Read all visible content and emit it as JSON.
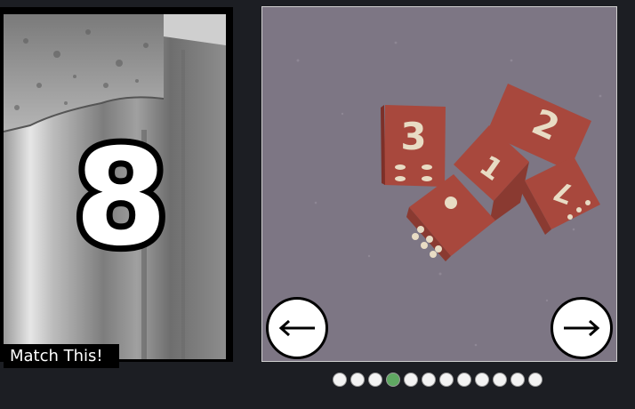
{
  "reference": {
    "caption": "Match This!",
    "digit": "8"
  },
  "carousel": {
    "prev_label": "previous",
    "next_label": "next",
    "slide_count": 12,
    "active_index": 3,
    "dice_numbers": [
      "3",
      "1",
      "2",
      "7"
    ]
  },
  "colors": {
    "background": "#1c1e23",
    "dot_active": "#5fa862",
    "dot_inactive": "#f3f3f3",
    "die_face": "#a8483d",
    "die_pip": "#e8dcc4"
  }
}
